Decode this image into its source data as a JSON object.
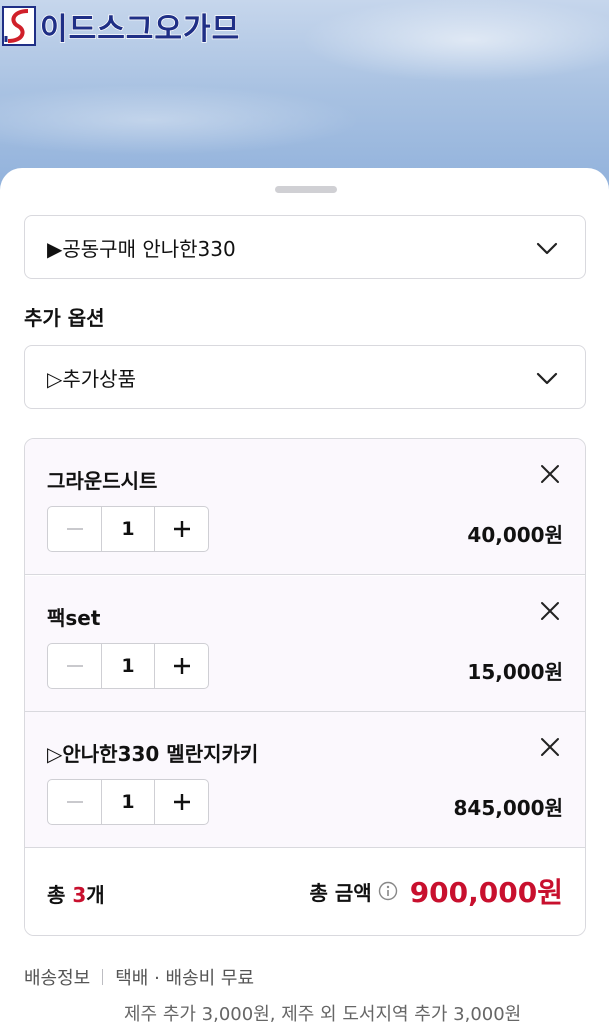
{
  "header": {
    "logo_text": "이드스그오가므",
    "colors": {
      "logo_blue": "#1f2f86",
      "logo_red": "#d0202a"
    }
  },
  "options": {
    "main_select": {
      "value": "▶공동구매 안나한330",
      "icon": "chevron-down-icon"
    },
    "extra_label": "추가 옵션",
    "extra_select": {
      "value": "▷추가상품",
      "icon": "chevron-down-icon"
    }
  },
  "cart": {
    "items": [
      {
        "name": "그라운드시트",
        "qty": "1",
        "price": "40,000원"
      },
      {
        "name": "팩set",
        "qty": "1",
        "price": "15,000원"
      },
      {
        "name": "▷안나한330 멜란지카키",
        "qty": "1",
        "price": "845,000원"
      }
    ],
    "total": {
      "count_prefix": "총 ",
      "count": "3",
      "count_suffix": "개",
      "amount_label": "총 금액",
      "amount": "900,000원",
      "accent": "#c8102e"
    }
  },
  "shipping": {
    "label": "배송정보",
    "method": "택배 · 배송비 무료",
    "note": "제주 추가 3,000원, 제주 외 도서지역 추가 3,000원"
  }
}
